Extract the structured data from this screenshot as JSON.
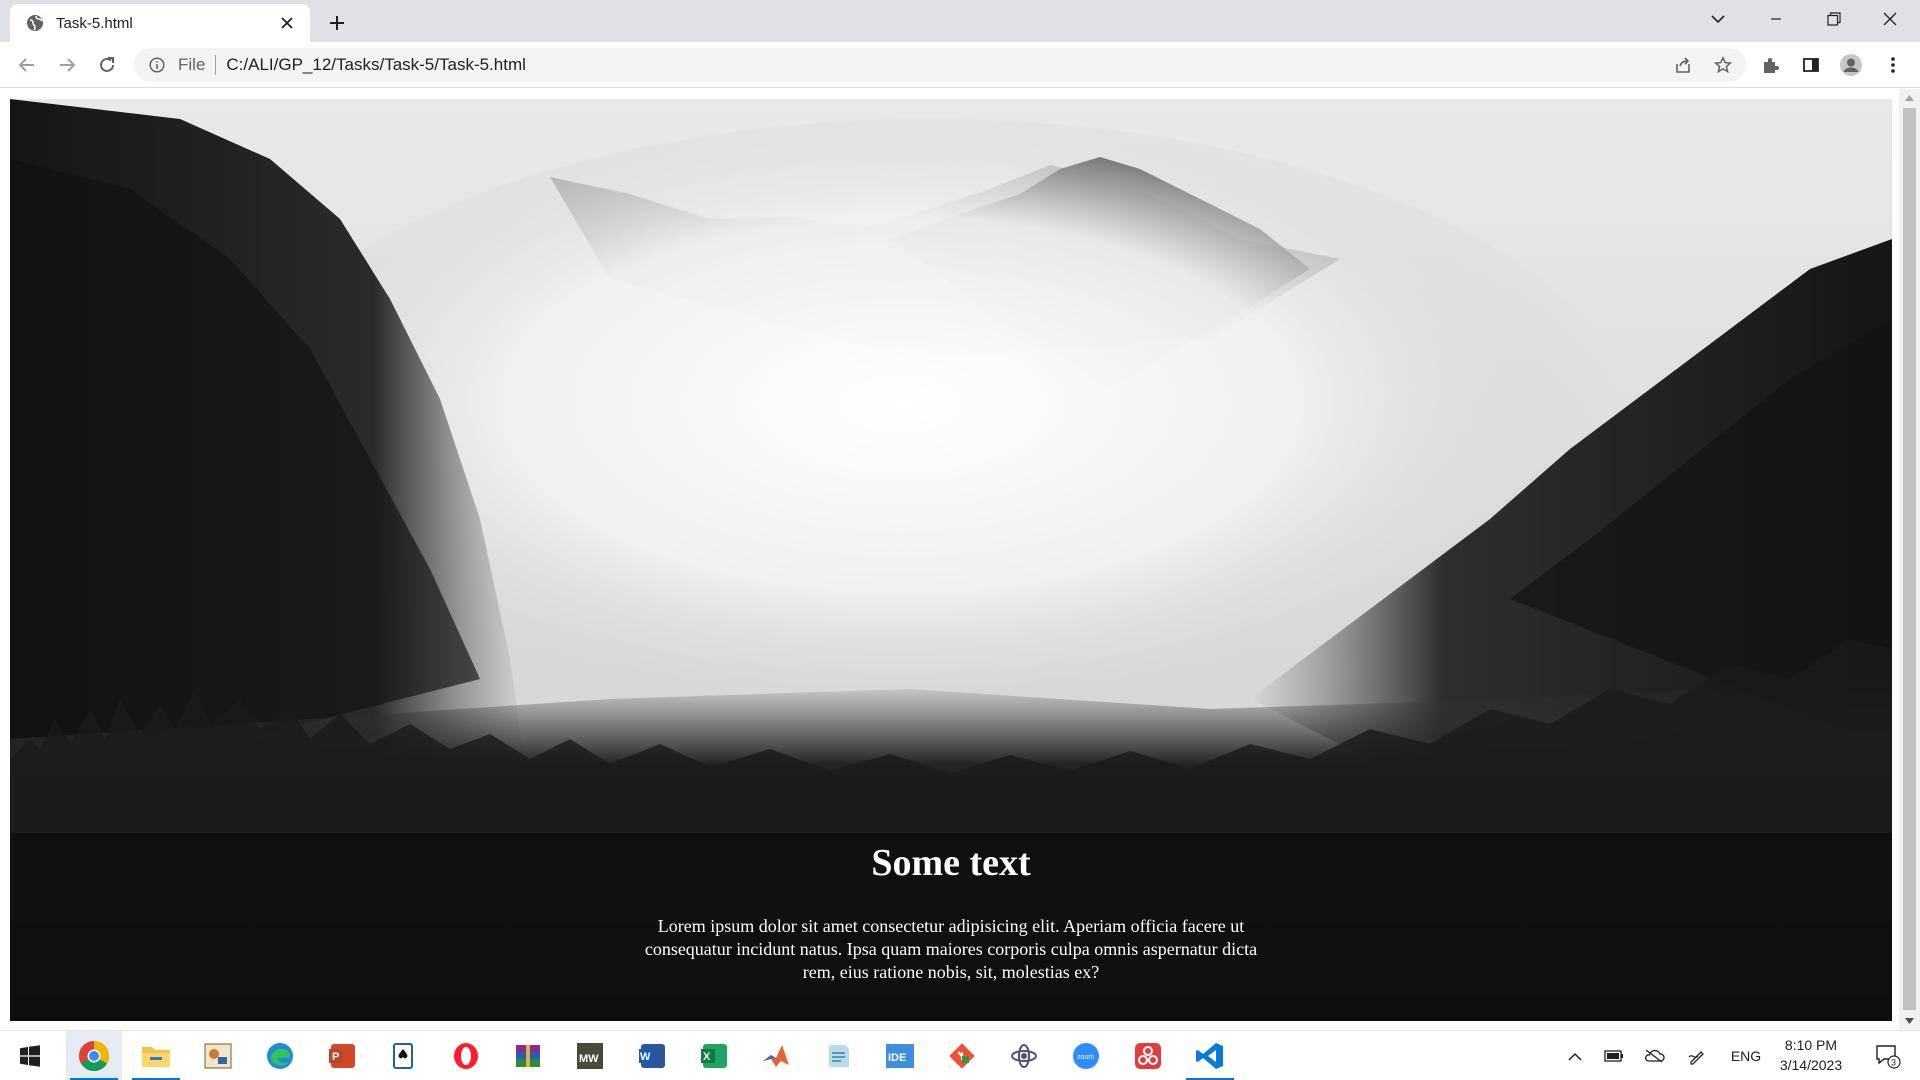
{
  "browser": {
    "tab_title": "Task-5.html",
    "omnibox_chip": "File",
    "url": "C:/ALI/GP_12/Tasks/Task-5/Task-5.html"
  },
  "page": {
    "heading": "Some text",
    "paragraph": "Lorem ipsum dolor sit amet consectetur adipisicing elit. Aperiam officia facere ut consequatur incidunt natus. Ipsa quam maiores corporis culpa omnis aspernatur dicta rem, eius ratione nobis, sit, molestias ex?"
  },
  "taskbar": {
    "apps": [
      "windows-start",
      "chrome",
      "file-explorer",
      "paint",
      "edge",
      "powerpoint",
      "solitaire",
      "opera",
      "winrar",
      "mw-game",
      "word",
      "excel",
      "matlab",
      "notepad",
      "ide",
      "git",
      "network-tool",
      "zoom",
      "davinci",
      "vscode"
    ],
    "language": "ENG",
    "time": "8:10 PM",
    "date": "3/14/2023",
    "notification_count": "3"
  },
  "colors": {
    "tabstrip_bg": "#dee1e6",
    "accent": "#0078d4"
  }
}
